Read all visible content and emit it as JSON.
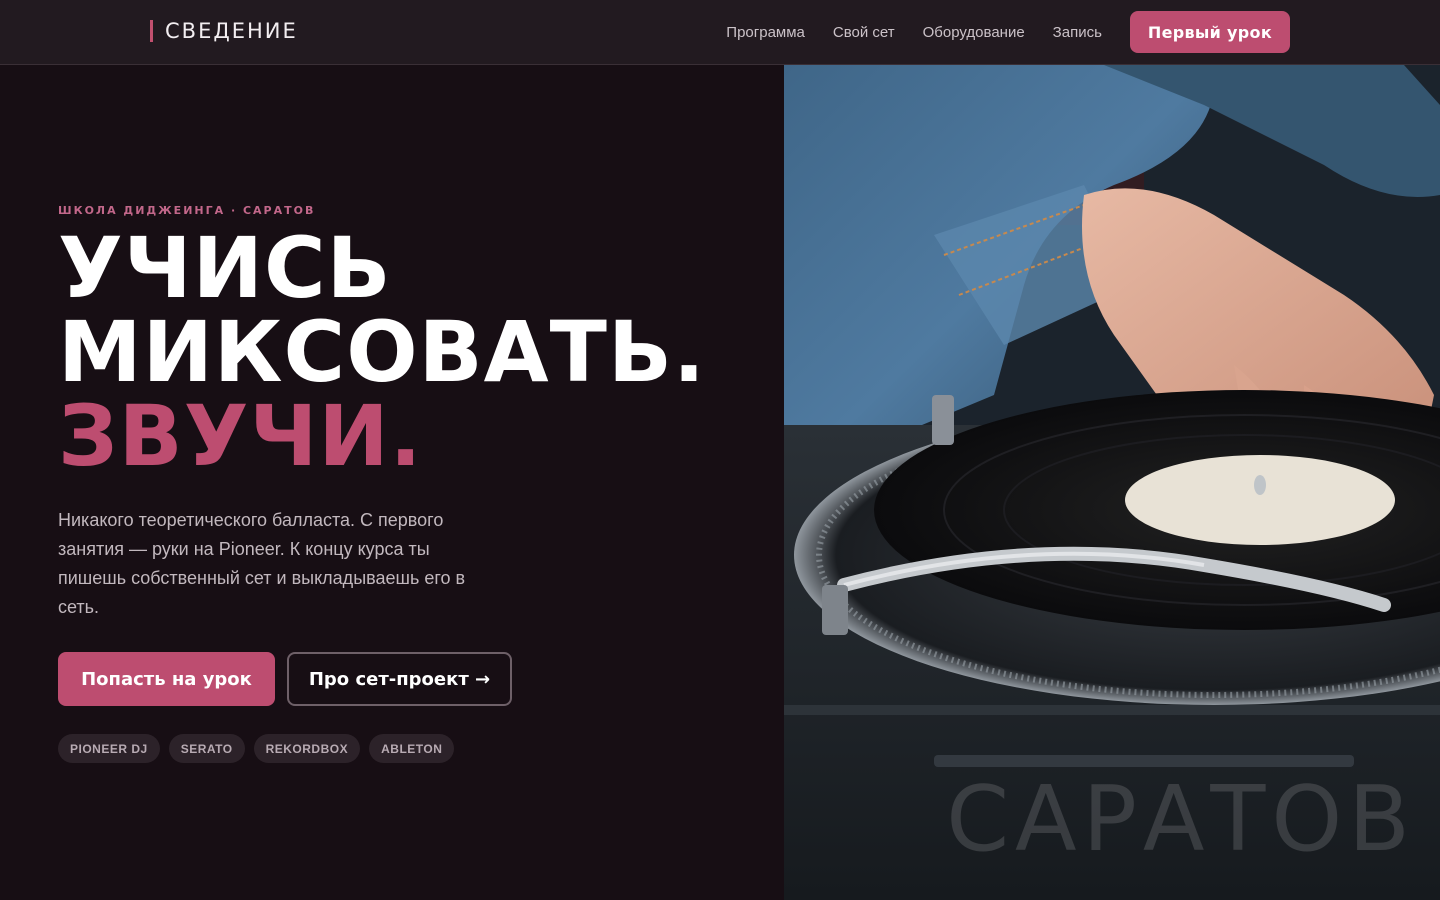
{
  "header": {
    "brand": "СВЕДЕНИЕ",
    "nav": [
      "Программа",
      "Свой сет",
      "Оборудование",
      "Запись"
    ],
    "cta": "Первый урок"
  },
  "hero": {
    "eyebrow": "ШКОЛА ДИДЖЕИНГА · САРАТОВ",
    "headline_line1": "УЧИСЬ",
    "headline_line2": "МИКСОВАТЬ.",
    "headline_accent": "ЗВУЧИ",
    "headline_accent_dot": ".",
    "lead": "Никакого теоретического балласта. С первого занятия — руки на Pioneer. К концу курса ты пишешь собственный сет и выкладываешь его в сеть.",
    "primary_button": "Попасть на урок",
    "secondary_button": "Про сет-проект →",
    "tags": [
      "PIONEER DJ",
      "SERATO",
      "REKORDBOX",
      "ABLETON"
    ]
  },
  "photo": {
    "city_overlay": "САРАТОВ"
  },
  "colors": {
    "accent": "#bd4d70",
    "background": "#170e14",
    "header": "#221a20"
  }
}
